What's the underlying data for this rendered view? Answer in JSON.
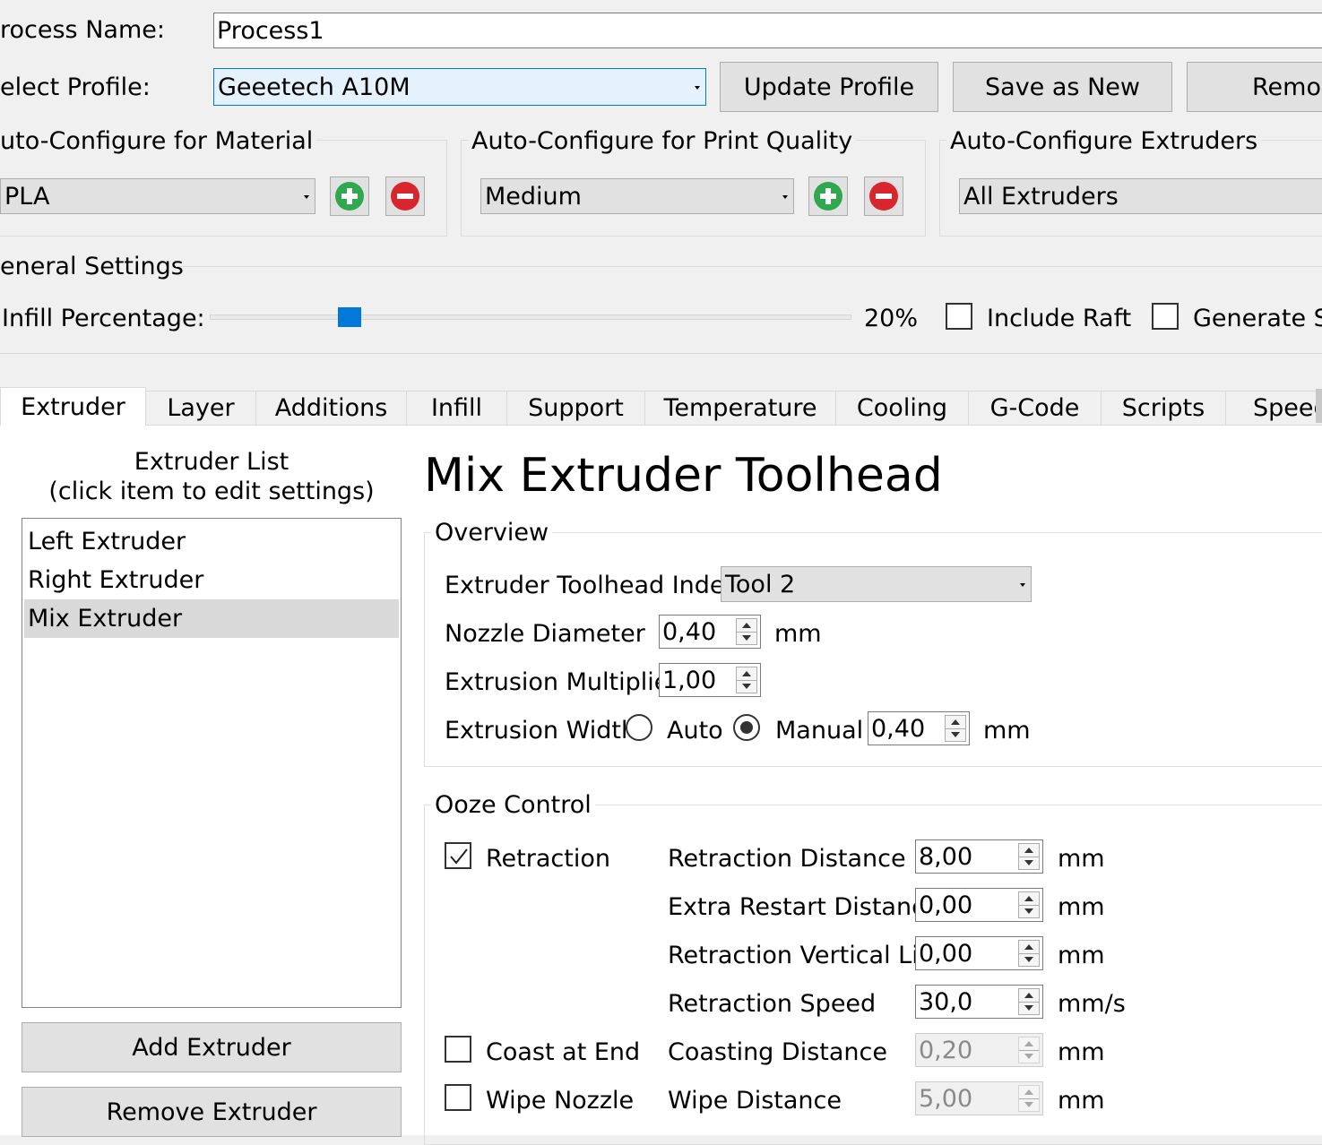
{
  "header": {
    "process_name_label": "rocess Name:",
    "process_name_value": "Process1",
    "select_profile_label": "elect Profile:",
    "profile_value": "Geeetech A10M",
    "update_profile": "Update Profile",
    "save_as_new": "Save as New",
    "remove": "Remov"
  },
  "autoconfig": {
    "material_title": "uto-Configure for Material",
    "material_value": "PLA",
    "quality_title": "Auto-Configure for Print Quality",
    "quality_value": "Medium",
    "extruders_title": "Auto-Configure Extruders",
    "extruders_value": "All Extruders"
  },
  "general": {
    "title": "eneral Settings",
    "infill_label": "Infill Percentage:",
    "infill_value_text": "20%",
    "infill_fraction": 0.2,
    "include_raft": "Include Raft",
    "include_raft_checked": false,
    "generate_support": "Generate Su",
    "generate_support_checked": false
  },
  "tabs": [
    "Extruder",
    "Layer",
    "Additions",
    "Infill",
    "Support",
    "Temperature",
    "Cooling",
    "G-Code",
    "Scripts",
    "Speed"
  ],
  "active_tab": "Extruder",
  "extruder_list": {
    "title_line1": "Extruder List",
    "title_line2": "(click item to edit settings)",
    "items": [
      "Left Extruder",
      "Right Extruder",
      "Mix Extruder"
    ],
    "selected": "Mix Extruder",
    "add_button": "Add Extruder",
    "remove_button": "Remove Extruder"
  },
  "editor": {
    "heading": "Mix Extruder Toolhead",
    "overview": {
      "title": "Overview",
      "toolhead_index_label": "Extruder Toolhead Index",
      "toolhead_index_value": "Tool 2",
      "nozzle_label": "Nozzle Diameter",
      "nozzle_value": "0,40",
      "nozzle_unit": "mm",
      "multiplier_label": "Extrusion Multiplier",
      "multiplier_value": "1,00",
      "width_label": "Extrusion Width",
      "auto_label": "Auto",
      "manual_label": "Manual",
      "width_mode": "Manual",
      "width_value": "0,40",
      "width_unit": "mm"
    },
    "ooze": {
      "title": "Ooze Control",
      "retraction_label": "Retraction",
      "retraction_checked": true,
      "coast_label": "Coast at End",
      "coast_checked": false,
      "wipe_label": "Wipe Nozzle",
      "wipe_checked": false,
      "rows": [
        {
          "label": "Retraction Distance",
          "value": "8,00",
          "unit": "mm"
        },
        {
          "label": "Extra Restart Distance",
          "value": "0,00",
          "unit": "mm"
        },
        {
          "label": "Retraction Vertical Lift",
          "value": "0,00",
          "unit": "mm"
        },
        {
          "label": "Retraction Speed",
          "value": "30,0",
          "unit": "mm/s"
        },
        {
          "label": "Coasting Distance",
          "value": "0,20",
          "unit": "mm"
        },
        {
          "label": "Wipe Distance",
          "value": "5,00",
          "unit": "mm"
        }
      ]
    }
  },
  "icons": {
    "add": "plus-circle-icon",
    "remove": "minus-circle-icon",
    "dropdown": "chevron-down-icon"
  },
  "colors": {
    "accent": "#0078d7",
    "add_green": "#2fa84f",
    "remove_red": "#d8262e",
    "window_bg": "#f0f0f0"
  }
}
